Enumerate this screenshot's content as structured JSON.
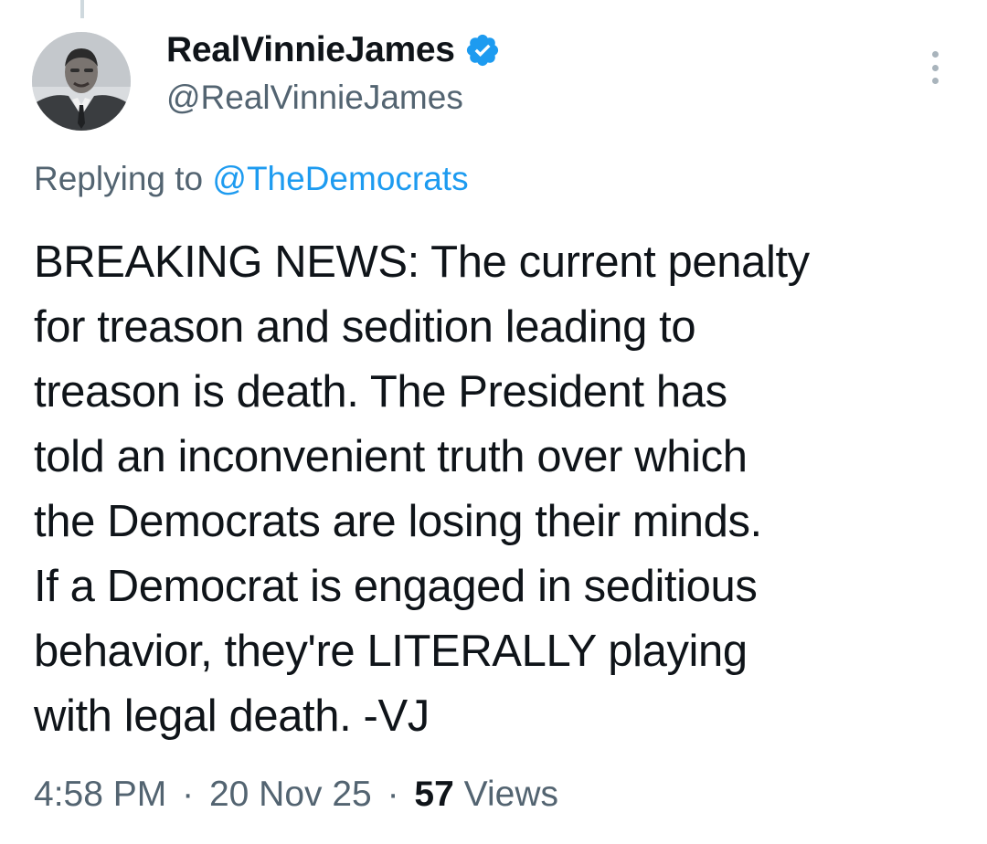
{
  "author": {
    "display_name": "RealVinnieJames",
    "handle": "@RealVinnieJames",
    "verified": true,
    "verified_color": "#1d9bf0"
  },
  "reply": {
    "prefix": "Replying to",
    "mention": "@TheDemocrats",
    "mention_color": "#1d9bf0"
  },
  "tweet": {
    "lines": [
      "BREAKING NEWS: The current penalty",
      "for treason and sedition leading to",
      "treason is death. The President has",
      "told an inconvenient truth over which",
      "the Democrats are losing their minds.",
      "If a Democrat is engaged in seditious",
      "behavior, they're LITERALLY playing",
      "with legal death. -VJ"
    ]
  },
  "meta": {
    "time": "4:58 PM",
    "separator": "·",
    "date": "20 Nov 25",
    "views_count": "57",
    "views_label": "Views"
  },
  "icons": {
    "verified": "verified-badge-icon",
    "more": "more-options-icon"
  }
}
